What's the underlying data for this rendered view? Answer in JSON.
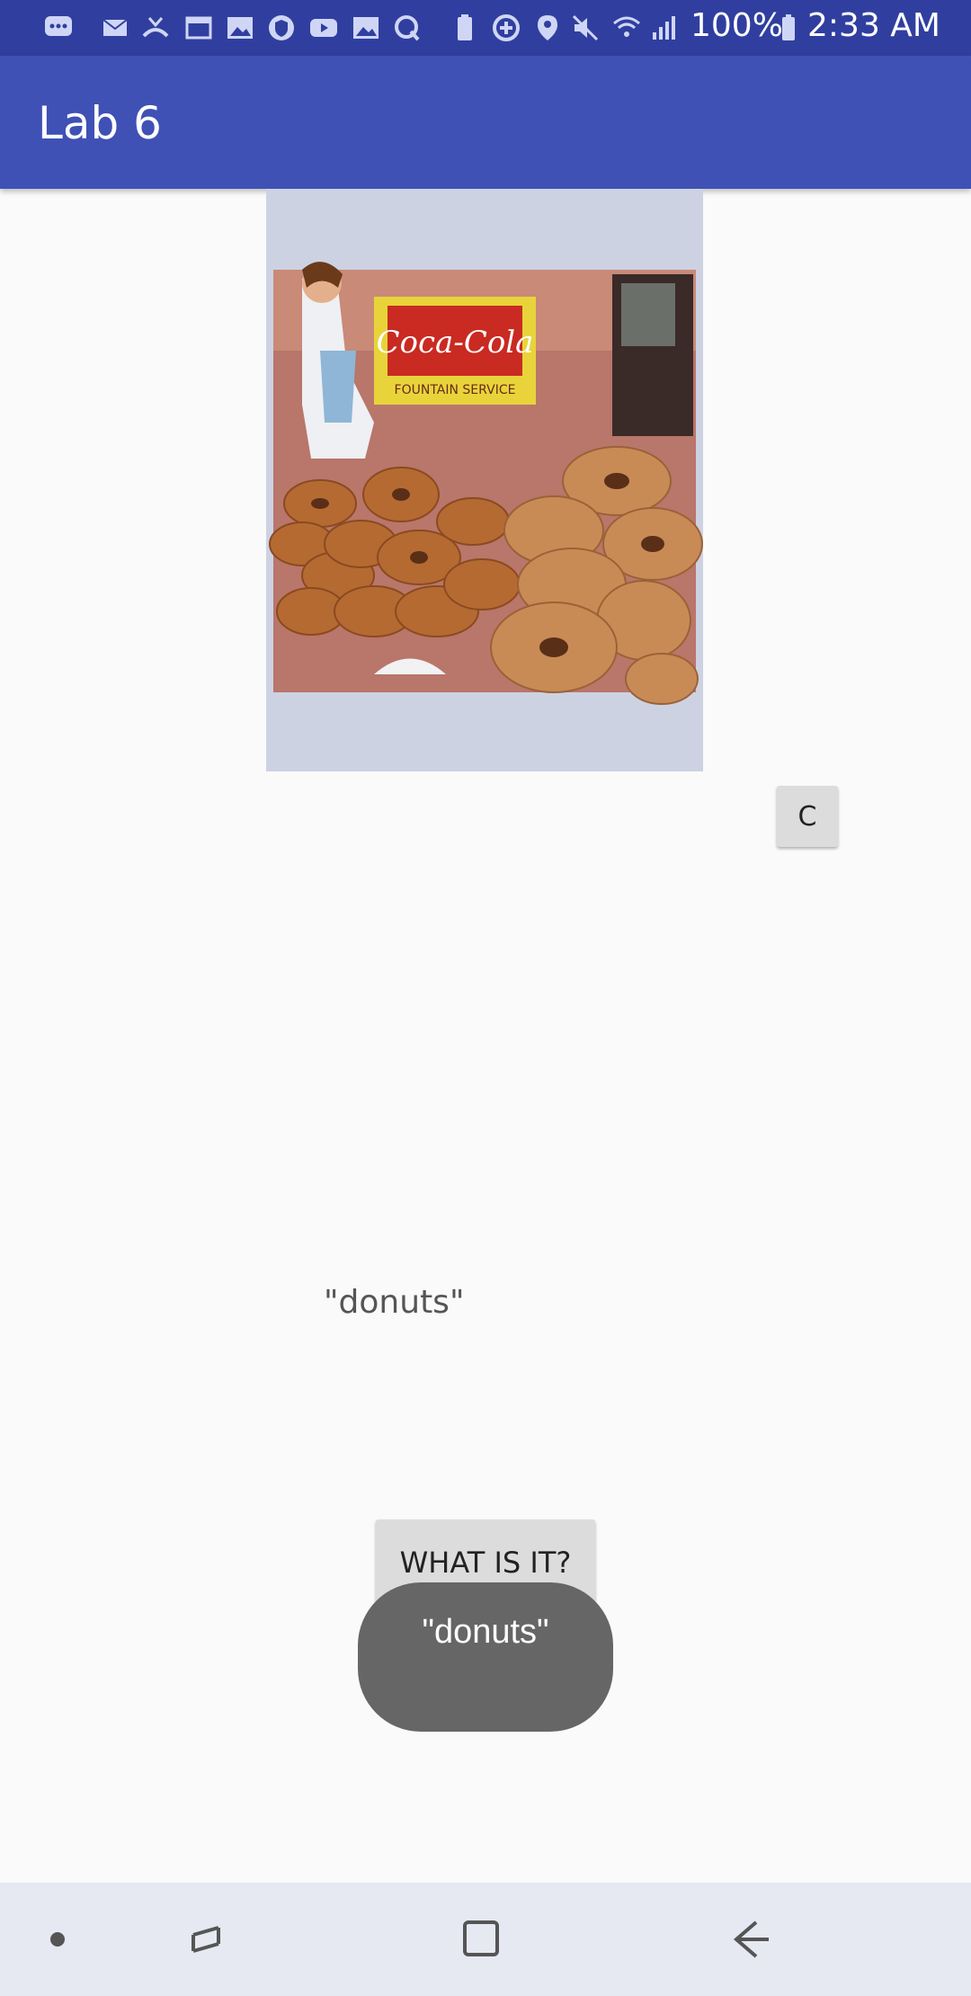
{
  "status_bar": {
    "battery": "100%",
    "time": "2:33 AM",
    "icons": [
      "messages-icon",
      "mail-icon",
      "missed-call-icon",
      "window-icon",
      "image-icon",
      "shield-icon",
      "youtube-icon",
      "gallery-icon",
      "q-icon",
      "storage-icon",
      "data-saver-icon",
      "location-icon",
      "mute-icon",
      "wifi-icon",
      "signal-icon",
      "battery-icon"
    ]
  },
  "app_bar": {
    "title": "Lab 6"
  },
  "image": {
    "subject": "donuts",
    "sign_text": "Coca-Cola",
    "sign_subtext": "FOUNTAIN SERVICE"
  },
  "buttons": {
    "c_label": "C",
    "what_label": "WHAT IS IT?"
  },
  "result": {
    "text": "\"donuts\""
  },
  "toast": {
    "text": "\"donuts\""
  },
  "colors": {
    "status_bar": "#303f9f",
    "app_bar": "#3f51b5",
    "background": "#fafafa",
    "toast": "#666666"
  }
}
